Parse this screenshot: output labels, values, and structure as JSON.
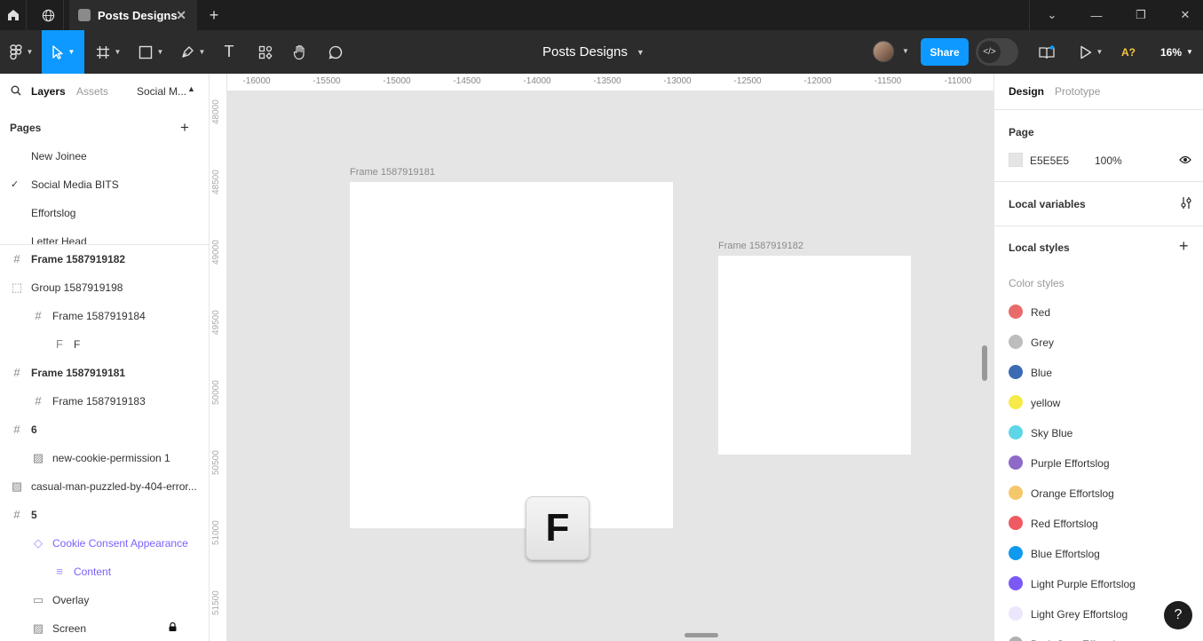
{
  "tabbar": {
    "tab_title": "Posts Designs",
    "close_glyph": "✕",
    "new_tab_glyph": "+",
    "window_controls": [
      "⌄",
      "—",
      "❐",
      "✕"
    ]
  },
  "toolbar": {
    "doc_title": "Posts Designs",
    "share_label": "Share",
    "dev_mode_glyph": "</>",
    "assistant_label": "A?",
    "zoom_label": "16%",
    "text_tool_glyph": "T"
  },
  "left_panel": {
    "tabs": {
      "layers": "Layers",
      "assets": "Assets",
      "page_selector": "Social M..."
    },
    "pages_heading": "Pages",
    "add_glyph": "+",
    "pages": [
      {
        "name": "New Joinee",
        "current": false
      },
      {
        "name": "Social Media BITS",
        "current": true
      },
      {
        "name": "Effortslog",
        "current": false
      },
      {
        "name": "Letter Head",
        "current": false
      }
    ],
    "check_glyph": "✓",
    "layers": [
      {
        "name": "Frame 1587919182",
        "icon": "frame-icon",
        "glyph": "#",
        "indent": 0,
        "bold": true
      },
      {
        "name": "Group 1587919198",
        "icon": "group-icon",
        "glyph": "⬚",
        "indent": 0,
        "bold": false
      },
      {
        "name": "Frame 1587919184",
        "icon": "frame-icon",
        "glyph": "#",
        "indent": 1,
        "bold": false
      },
      {
        "name": "F",
        "icon": "text-icon",
        "glyph": "F",
        "indent": 2,
        "bold": false
      },
      {
        "name": "Frame 1587919181",
        "icon": "frame-icon",
        "glyph": "#",
        "indent": 0,
        "bold": true
      },
      {
        "name": "Frame 1587919183",
        "icon": "frame-icon",
        "glyph": "#",
        "indent": 1,
        "bold": false
      },
      {
        "name": "6",
        "icon": "frame-icon",
        "glyph": "#",
        "indent": 0,
        "bold": true
      },
      {
        "name": "new-cookie-permission 1",
        "icon": "image-icon",
        "glyph": "▨",
        "indent": 1,
        "bold": false
      },
      {
        "name": "casual-man-puzzled-by-404-error...",
        "icon": "image-icon",
        "glyph": "▨",
        "indent": 0,
        "bold": false
      },
      {
        "name": "5",
        "icon": "frame-icon",
        "glyph": "#",
        "indent": 0,
        "bold": true
      },
      {
        "name": "Cookie Consent Appearance",
        "icon": "component-icon",
        "glyph": "◇",
        "indent": 1,
        "bold": false,
        "purple": true
      },
      {
        "name": "Content",
        "icon": "auto-layout-icon",
        "glyph": "≡",
        "indent": 2,
        "bold": false,
        "purple": true
      },
      {
        "name": "Overlay",
        "icon": "rectangle-icon",
        "glyph": "▭",
        "indent": 1,
        "bold": false
      },
      {
        "name": "Screen",
        "icon": "image-icon",
        "glyph": "▨",
        "indent": 1,
        "bold": false,
        "locked": true
      }
    ]
  },
  "canvas": {
    "ruler_x": [
      "-16000",
      "-15500",
      "-15000",
      "-14500",
      "-14000",
      "-13500",
      "-13000",
      "-12500",
      "-12000",
      "-11500",
      "-11000"
    ],
    "ruler_y": [
      "48000",
      "48500",
      "49000",
      "49500",
      "50000",
      "50500",
      "51000",
      "51500"
    ],
    "frame_a_label": "Frame 1587919181",
    "frame_b_label": "Frame 1587919182",
    "key_letter": "F"
  },
  "right_panel": {
    "tabs": {
      "design": "Design",
      "prototype": "Prototype"
    },
    "page_heading": "Page",
    "page_color_hex": "E5E5E5",
    "page_opacity": "100%",
    "local_variables": "Local variables",
    "local_styles": "Local styles",
    "color_styles_heading": "Color styles",
    "add_glyph": "+",
    "color_styles": [
      {
        "name": "Red",
        "color": "#e96a6a"
      },
      {
        "name": "Grey",
        "color": "#bdbdbd"
      },
      {
        "name": "Blue",
        "color": "#3d6bb3"
      },
      {
        "name": "yellow",
        "color": "#f6ea4a"
      },
      {
        "name": "Sky Blue",
        "color": "#5dd6e8"
      },
      {
        "name": "Purple Effortslog",
        "color": "#8d6ac8"
      },
      {
        "name": "Orange Effortslog",
        "color": "#f5c76b"
      },
      {
        "name": "Red Effortslog",
        "color": "#ef5a63"
      },
      {
        "name": "Blue Effortslog",
        "color": "#0f9af0"
      },
      {
        "name": "Light Purple Effortslog",
        "color": "#7a5af5"
      },
      {
        "name": "Light Grey Effortslog",
        "color": "#ebe6fb"
      },
      {
        "name": "Dark Grey Effortslog",
        "color": "#b0b0b0"
      }
    ]
  },
  "help_glyph": "?",
  "accent_color": "#0d99ff"
}
